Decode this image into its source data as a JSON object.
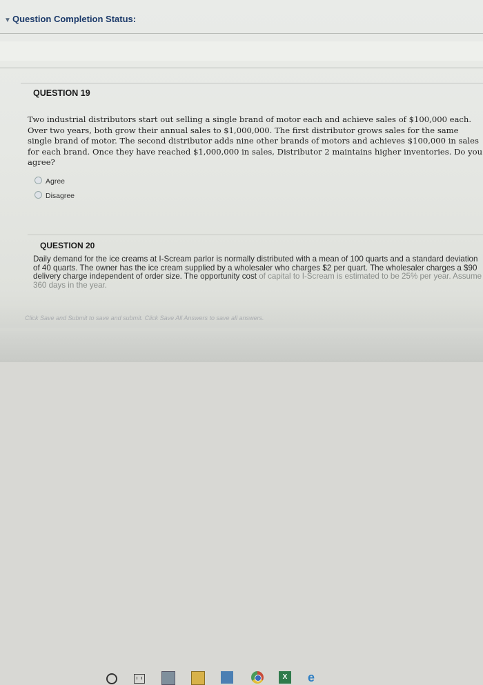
{
  "status": {
    "title": "Question Completion Status:"
  },
  "question19": {
    "label": "QUESTION 19",
    "text": "Two industrial distributors start out selling a single brand of motor each and achieve sales of $100,000 each. Over two years, both grow their annual sales to $1,000,000. The first distributor grows sales for the same single brand of motor. The second distributor adds nine other brands of motors and achieves $100,000 in sales for each brand. Once they have reached $1,000,000 in sales, Distributor 2 maintains higher inventories. Do you agree?",
    "options": [
      "Agree",
      "Disagree"
    ]
  },
  "question20": {
    "label": "QUESTION 20",
    "text": "Daily demand for the ice creams at I-Scream parlor is normally distributed with a mean of 100 quarts and a standard deviation of 40 quarts. The owner has the ice cream supplied by a wholesaler who charges $2 per quart. The wholesaler charges a $90 delivery charge independent of order size. The opportunity cost",
    "text_cut": "of capital to I-Scream is estimated to be 25% per year. Assume 360 days in the year."
  },
  "footer": {
    "note": "Click Save and Submit to save and submit. Click Save All Answers to save all answers."
  },
  "taskbar": {
    "icons": [
      "search-icon",
      "task-view-icon",
      "store-icon",
      "file-explorer-icon",
      "app-icon",
      "chrome-icon",
      "excel-icon",
      "edge-icon"
    ],
    "excel_label": "X",
    "edge_label": "e"
  }
}
